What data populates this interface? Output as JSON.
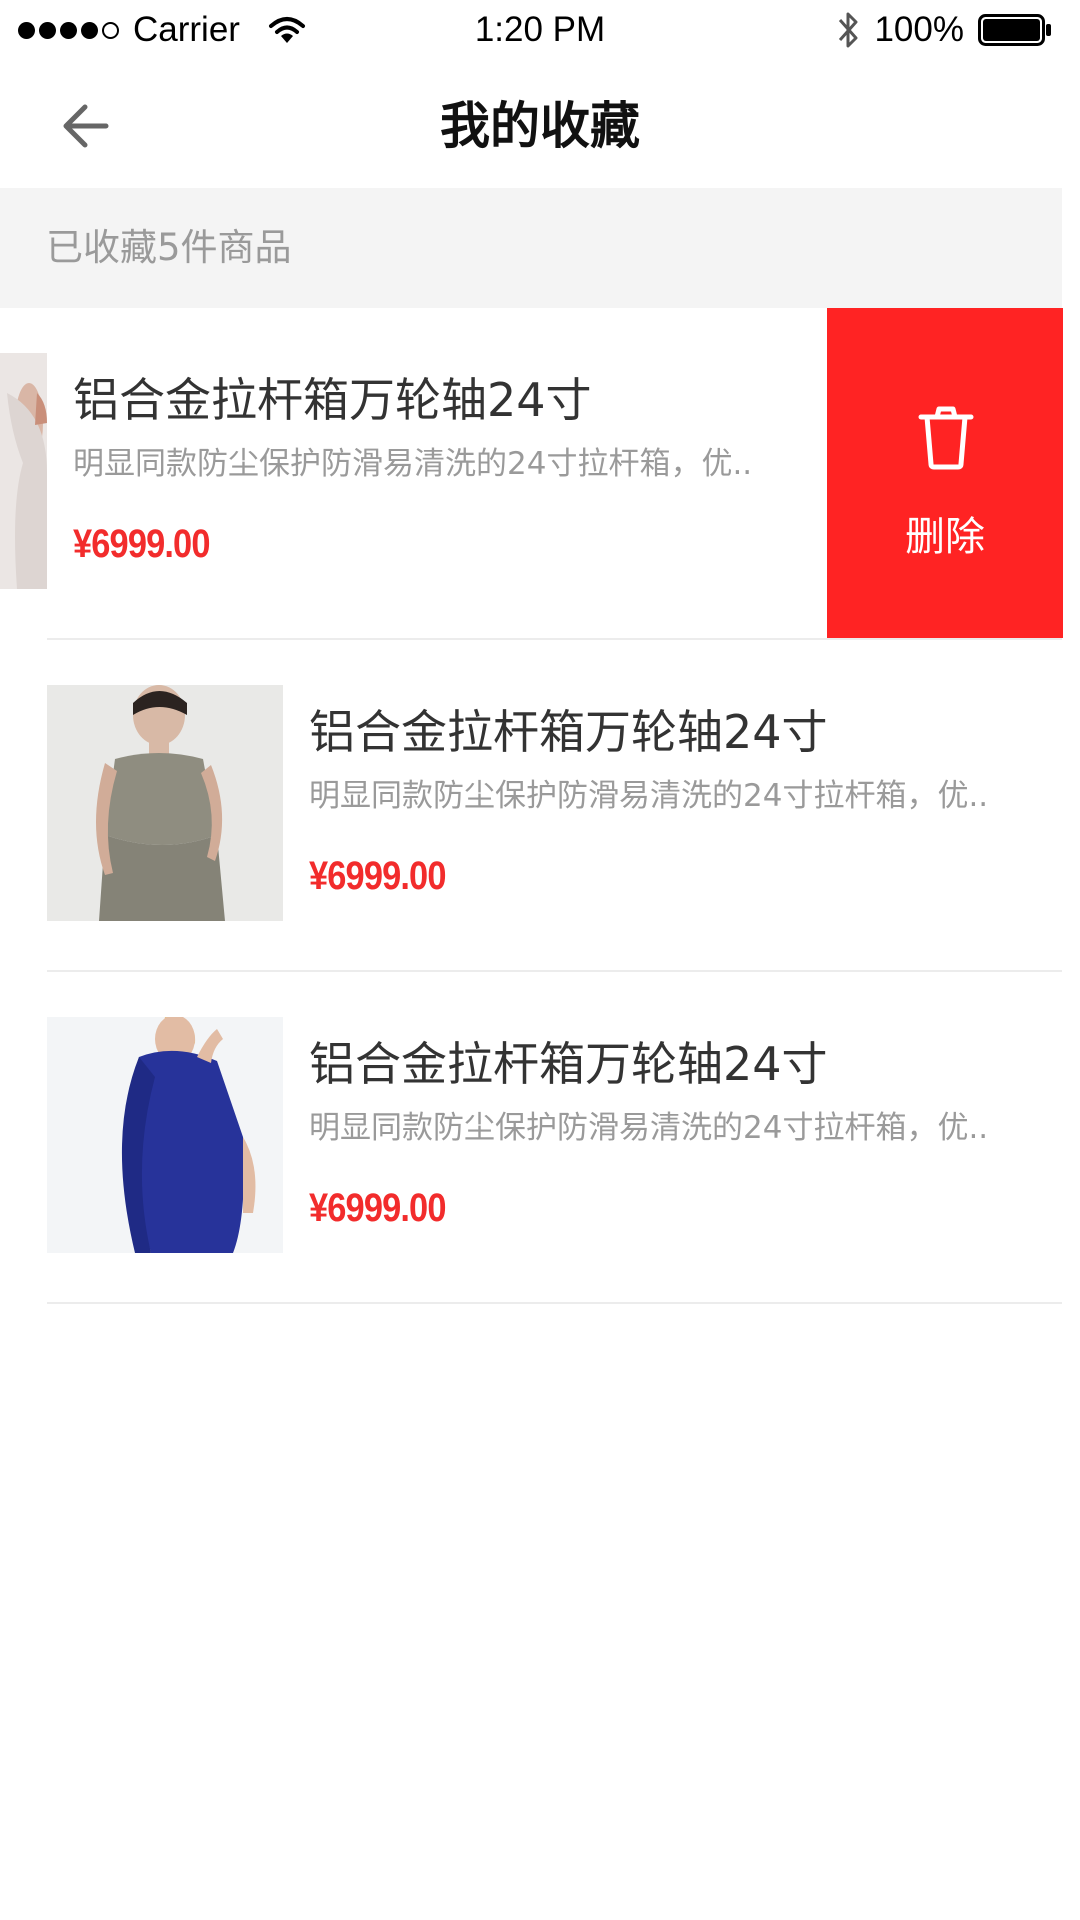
{
  "status_bar": {
    "carrier": "Carrier",
    "time": "1:20 PM",
    "battery": "100%"
  },
  "nav": {
    "title": "我的收藏",
    "back_icon": "arrow-left-icon"
  },
  "summary": {
    "text": "已收藏5件商品"
  },
  "items": [
    {
      "title": "铝合金拉杆箱万轮轴24寸",
      "description": "明显同款防尘保护防滑易清洗的24寸拉杆箱，优..",
      "price": "¥6999.00",
      "delete_label": "删除",
      "delete_icon": "trash-icon"
    },
    {
      "title": "铝合金拉杆箱万轮轴24寸",
      "description": "明显同款防尘保护防滑易清洗的24寸拉杆箱，优..",
      "price": "¥6999.00"
    },
    {
      "title": "铝合金拉杆箱万轮轴24寸",
      "description": "明显同款防尘保护防滑易清洗的24寸拉杆箱，优..",
      "price": "¥6999.00"
    }
  ],
  "colors": {
    "accent_red": "#ff2323",
    "price_red": "#f22c2c",
    "summary_bg": "#f4f4f4",
    "muted_text": "#9a9a9a"
  }
}
